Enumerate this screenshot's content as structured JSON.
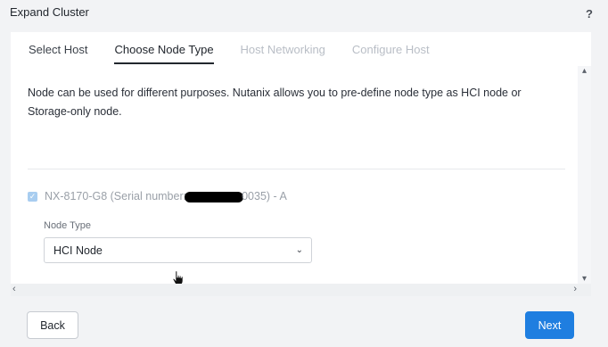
{
  "dialog": {
    "title": "Expand Cluster",
    "help_label": "?"
  },
  "tabs": [
    {
      "label": "Select Host",
      "state": "done"
    },
    {
      "label": "Choose Node Type",
      "state": "active"
    },
    {
      "label": "Host Networking",
      "state": "disabled"
    },
    {
      "label": "Configure Host",
      "state": "disabled"
    }
  ],
  "main": {
    "description": "Node can be used for different purposes. Nutanix allows you to pre-define node type as HCI node or Storage-only node.",
    "node": {
      "checked": true,
      "label_prefix": "NX-8170-G8 (Serial number:",
      "label_suffix": "0035) - A"
    },
    "node_type": {
      "label": "Node Type",
      "value": "HCI Node"
    }
  },
  "footer": {
    "back_label": "Back",
    "next_label": "Next"
  },
  "colors": {
    "accent": "#1f7ee0",
    "checkbox": "#a8cdf0"
  },
  "icons": {
    "help": "question-mark",
    "check": "checkmark",
    "select": "chevron-down",
    "scroll_up": "caret-up",
    "scroll_down": "caret-down",
    "scroll_left": "caret-left",
    "scroll_right": "caret-right",
    "pointer": "hand-cursor"
  }
}
